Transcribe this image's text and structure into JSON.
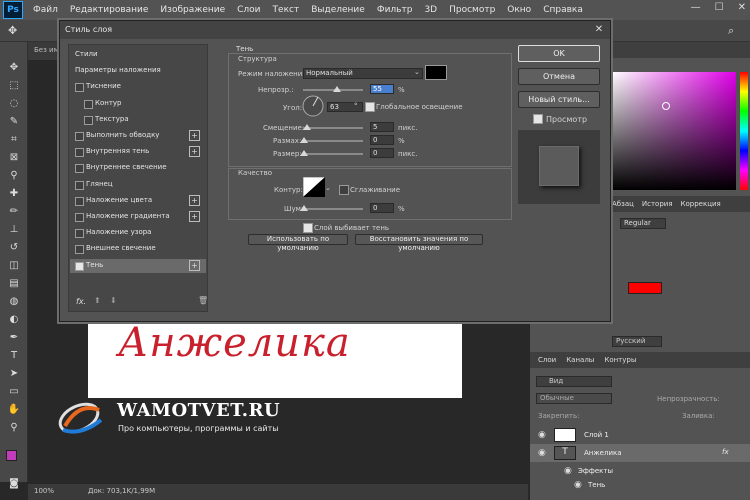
{
  "menubar": {
    "logo": "Ps",
    "items": [
      "Файл",
      "Редактирование",
      "Изображение",
      "Слои",
      "Текст",
      "Выделение",
      "Фильтр",
      "3D",
      "Просмотр",
      "Окно",
      "Справка"
    ]
  },
  "tab": {
    "label": "Без им"
  },
  "status": {
    "zoom": "100%",
    "doc": "Док: 703,1K/1,99M"
  },
  "canvas": {
    "text": "Анжелика"
  },
  "watermark": {
    "title": "WAMOTVET.RU",
    "subtitle": "Про компьютеры, программы и сайты"
  },
  "right": {
    "panel_tabs": [
      "Абзац",
      "История",
      "Коррекция"
    ],
    "font_style": "Regular",
    "font_name": "Русский",
    "swatch_color": "#ff0000",
    "layers_tabs": [
      "Слои",
      "Каналы",
      "Контуры"
    ],
    "layers_filter": "Вид",
    "blend": "Обычные",
    "opacity_label": "Непрозрачность:",
    "lock_label": "Закрепить:",
    "fill_label": "Заливка:",
    "layers": [
      {
        "name": "Слой 1"
      },
      {
        "name": "Анжелика"
      },
      {
        "name": "Эффекты"
      },
      {
        "name": "Тень"
      }
    ]
  },
  "dialog": {
    "title": "Стиль слоя",
    "close": "✕",
    "styles": [
      {
        "label": "Стили",
        "checkbox": false,
        "plus": false,
        "indent": false,
        "checked": false,
        "selected": false
      },
      {
        "label": "Параметры наложения",
        "checkbox": false,
        "plus": false,
        "indent": false,
        "checked": false,
        "selected": false
      },
      {
        "label": "Тиснение",
        "checkbox": true,
        "plus": false,
        "indent": false,
        "checked": false,
        "selected": false
      },
      {
        "label": "Контур",
        "checkbox": true,
        "plus": false,
        "indent": true,
        "checked": false,
        "selected": false
      },
      {
        "label": "Текстура",
        "checkbox": true,
        "plus": false,
        "indent": true,
        "checked": false,
        "selected": false
      },
      {
        "label": "Выполнить обводку",
        "checkbox": true,
        "plus": true,
        "indent": false,
        "checked": false,
        "selected": false
      },
      {
        "label": "Внутренняя тень",
        "checkbox": true,
        "plus": true,
        "indent": false,
        "checked": false,
        "selected": false
      },
      {
        "label": "Внутреннее свечение",
        "checkbox": true,
        "plus": false,
        "indent": false,
        "checked": false,
        "selected": false
      },
      {
        "label": "Глянец",
        "checkbox": true,
        "plus": false,
        "indent": false,
        "checked": false,
        "selected": false
      },
      {
        "label": "Наложение цвета",
        "checkbox": true,
        "plus": true,
        "indent": false,
        "checked": false,
        "selected": false
      },
      {
        "label": "Наложение градиента",
        "checkbox": true,
        "plus": true,
        "indent": false,
        "checked": false,
        "selected": false
      },
      {
        "label": "Наложение узора",
        "checkbox": true,
        "plus": false,
        "indent": false,
        "checked": false,
        "selected": false
      },
      {
        "label": "Внешнее свечение",
        "checkbox": true,
        "plus": false,
        "indent": false,
        "checked": false,
        "selected": false
      },
      {
        "label": "Тень",
        "checkbox": true,
        "plus": true,
        "indent": false,
        "checked": true,
        "selected": true
      }
    ],
    "fx_label": "fx.",
    "section_title": "Тень",
    "structure": {
      "title": "Структура",
      "blend_mode_label": "Режим наложения:",
      "blend_mode_value": "Нормальный",
      "shadow_color": "#000000",
      "opacity_label": "Непрозр.:",
      "opacity_value": "55",
      "opacity_unit": "%",
      "angle_label": "Угол:",
      "angle_value": "63",
      "angle_unit": "°",
      "global_light_label": "Глобальное освещение",
      "global_light_checked": true,
      "distance_label": "Смещение:",
      "distance_value": "5",
      "distance_unit": "пикс.",
      "spread_label": "Размах:",
      "spread_value": "0",
      "spread_unit": "%",
      "size_label": "Размер:",
      "size_value": "0",
      "size_unit": "пикс."
    },
    "quality": {
      "title": "Качество",
      "contour_label": "Контур:",
      "antialias_label": "Сглаживание",
      "antialias_checked": false,
      "noise_label": "Шум:",
      "noise_value": "0",
      "noise_unit": "%"
    },
    "knockout_label": "Слой выбивает тень",
    "knockout_checked": true,
    "default_btn": "Использовать по умолчанию",
    "reset_btn": "Восстановить значения по умолчанию",
    "ok": "OK",
    "cancel": "Отмена",
    "new_style": "Новый стиль...",
    "preview_label": "Просмотр",
    "preview_checked": true
  }
}
